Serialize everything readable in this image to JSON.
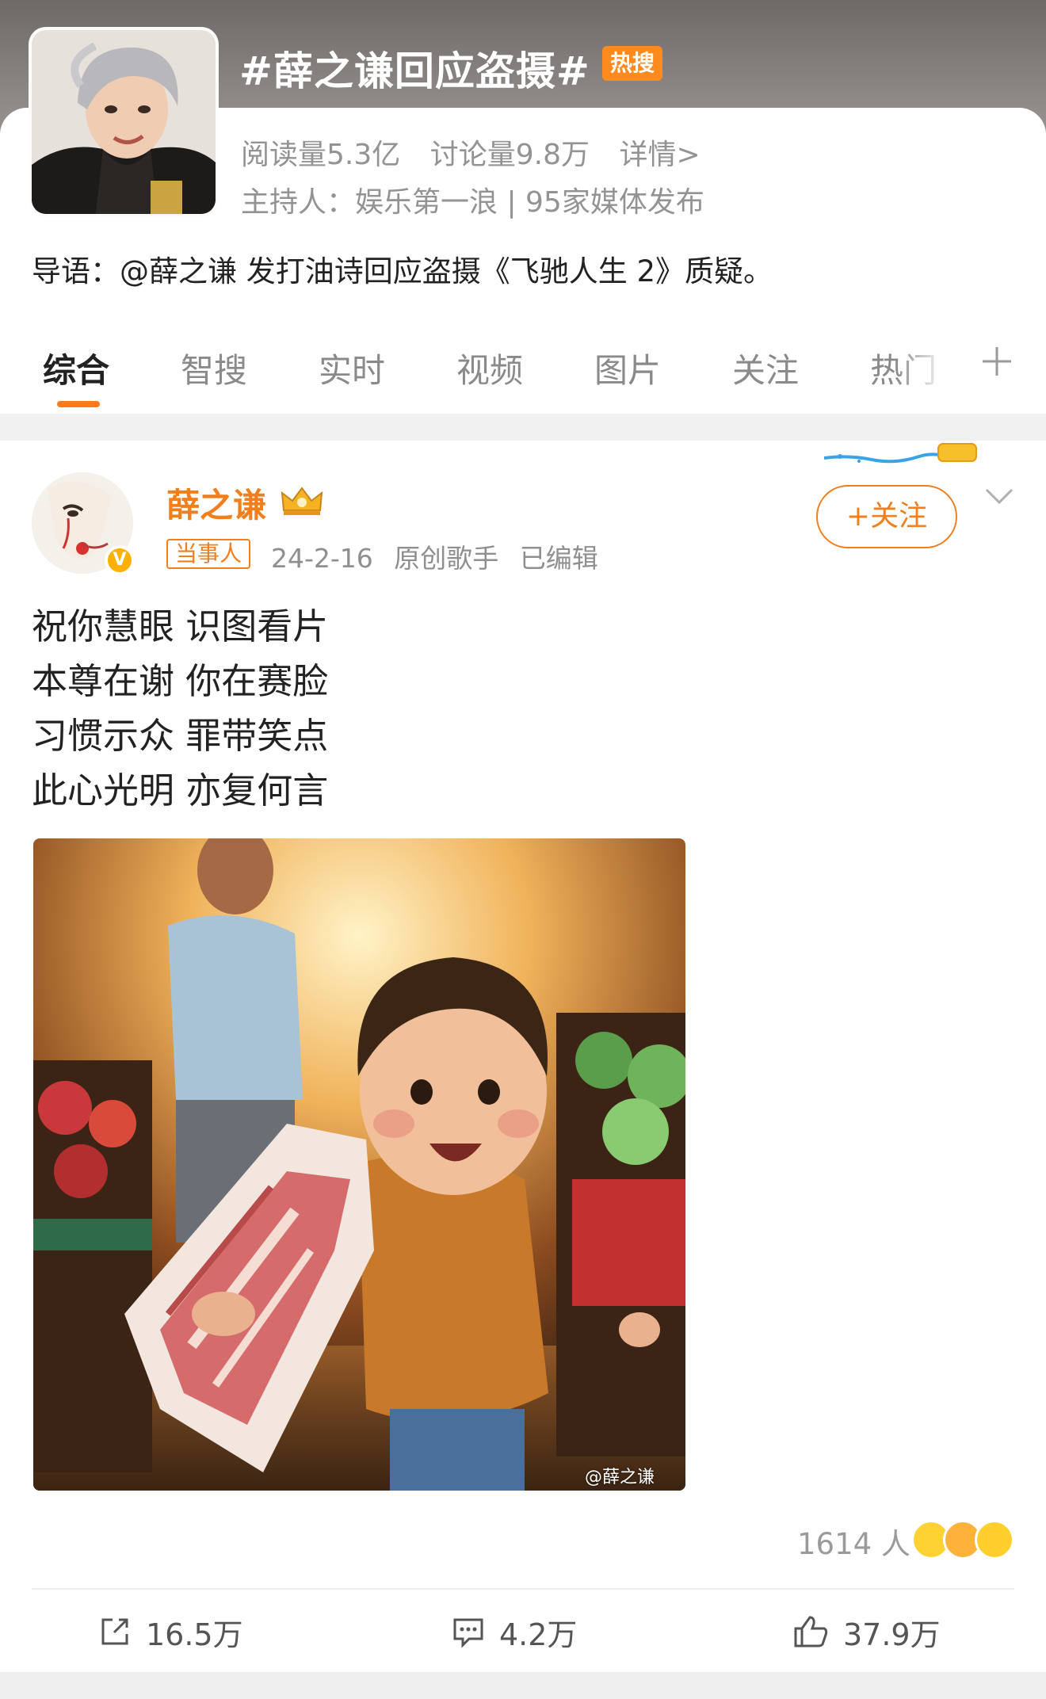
{
  "topic": {
    "title": "#薛之谦回应盗摄#",
    "badge": "热搜",
    "reads": "阅读量5.3亿",
    "discussions": "讨论量9.8万",
    "details_link": "详情>",
    "host": "主持人：娱乐第一浪 | 95家媒体发布",
    "intro": "导语：@薛之谦 发打油诗回应盗摄《飞驰人生 2》质疑。"
  },
  "tabs": [
    {
      "label": "综合"
    },
    {
      "label": "智搜"
    },
    {
      "label": "实时"
    },
    {
      "label": "视频"
    },
    {
      "label": "图片"
    },
    {
      "label": "关注"
    },
    {
      "label": "热门"
    }
  ],
  "post": {
    "author": "薛之谦",
    "badge": "当事人",
    "date": "24-2-16",
    "title": "原创歌手",
    "edited": "已编辑",
    "follow_label": "+关注",
    "verified_glyph": "V",
    "poem": [
      "祝你慧眼 识图看片",
      "本尊在谢 你在赛脸",
      "习惯示众 罪带笑点",
      "此心光明 亦复何言"
    ],
    "watermark": "@薛之谦",
    "reactions": "1614 人",
    "reposts": "16.5万",
    "comments": "4.2万",
    "likes": "37.9万"
  },
  "colors": {
    "accent": "#f07f1c",
    "hot_badge": "#ff8a1e",
    "tab_underline": "#ff7a1a"
  },
  "icons": [
    "plus-icon",
    "chevron-down-icon",
    "crown-icon",
    "share-icon",
    "comment-icon",
    "like-icon"
  ]
}
